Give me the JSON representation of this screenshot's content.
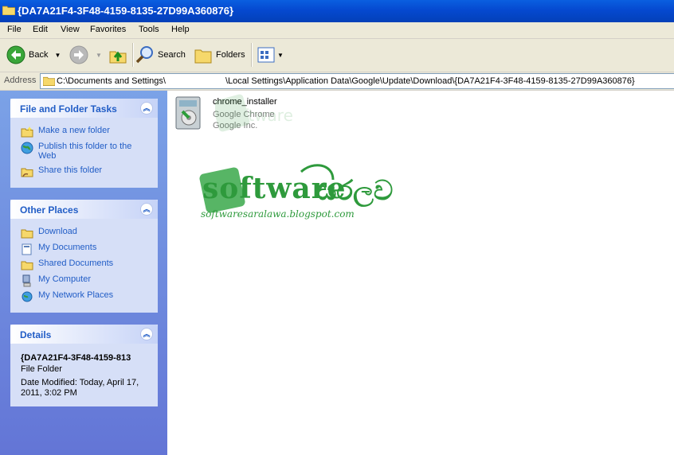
{
  "window": {
    "title": "{DA7A21F4-3F48-4159-8135-27D99A360876}"
  },
  "menu": {
    "items": [
      "File",
      "Edit",
      "View",
      "Favorites",
      "Tools",
      "Help"
    ]
  },
  "toolbar": {
    "back": "Back",
    "search": "Search",
    "folders": "Folders"
  },
  "address": {
    "label": "Address",
    "part1": "C:\\Documents and Settings\\",
    "part2": "\\Local Settings\\Application Data\\Google\\Update\\Download\\{DA7A21F4-3F48-4159-8135-27D99A360876}"
  },
  "tasks": {
    "title": "File and Folder Tasks",
    "items": [
      "Make a new folder",
      "Publish this folder to the Web",
      "Share this folder"
    ]
  },
  "other_places": {
    "title": "Other Places",
    "items": [
      "Download",
      "My Documents",
      "Shared Documents",
      "My Computer",
      "My Network Places"
    ]
  },
  "details": {
    "title": "Details",
    "name": "{DA7A21F4-3F48-4159-813",
    "type": "File Folder",
    "modified": "Date Modified: Today, April 17, 2011, 3:02 PM"
  },
  "file": {
    "name": "chrome_installer",
    "desc": "Google Chrome",
    "company": "Google Inc."
  },
  "watermark": {
    "word": "software",
    "script": "සරලව",
    "url": "softwaresaralawa.blogspot.com"
  }
}
